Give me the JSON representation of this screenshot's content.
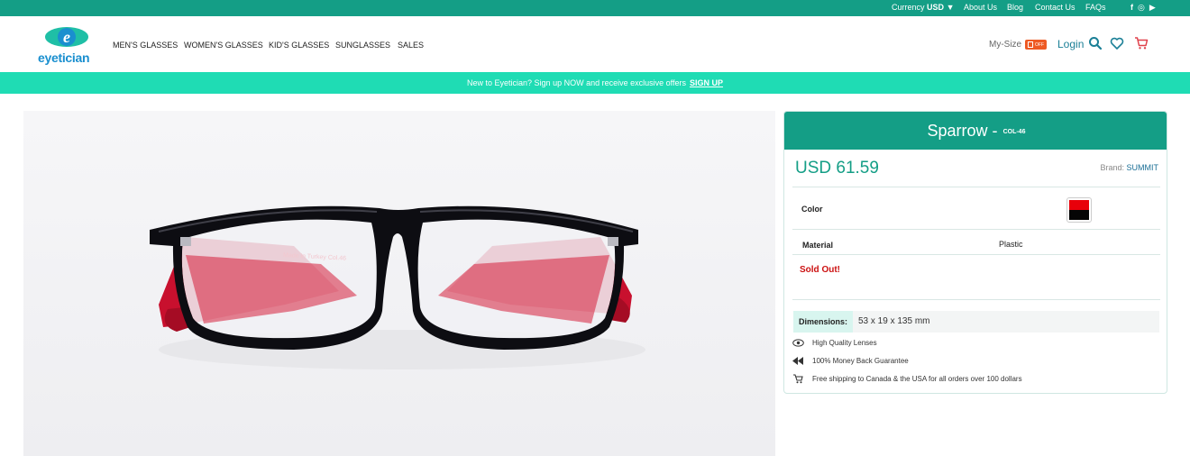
{
  "topbar": {
    "currency_label": "Currency",
    "currency_value": "USD",
    "currency_caret": "▼",
    "links": [
      "About Us",
      "Blog",
      "Contact Us",
      "FAQs"
    ],
    "social": [
      "f",
      "◎",
      "▶"
    ]
  },
  "header": {
    "logo_text": "eyetician",
    "nav": [
      "MEN'S GLASSES",
      "WOMEN'S GLASSES",
      "KID'S GLASSES",
      "SUNGLASSES",
      "SALES"
    ],
    "mysize_label": "My-Size",
    "mysize_badge": "OFF",
    "login_label": "Login"
  },
  "promo": {
    "text": "New to Eyetician? Sign up NOW and receive exclusive offers",
    "link": "SIGN UP"
  },
  "product": {
    "name": "Sparrow -",
    "code": "COL-46",
    "price": "USD 61.59",
    "brand_label": "Brand:",
    "brand_value": "SUMMIT",
    "color_label": "Color",
    "swatch_colors": {
      "top": "#e8000a",
      "bottom": "#050505"
    },
    "material_label": "Material",
    "material_value": "Plastic",
    "status": "Sold Out!",
    "dimensions_label": "Dimensions:",
    "dimensions_value": "53 x 19 x 135 mm",
    "features": [
      {
        "icon": "eye-icon",
        "text": "High Quality Lenses"
      },
      {
        "icon": "rewind-icon",
        "text": "100% Money Back Guarantee"
      },
      {
        "icon": "shipping-cart-icon",
        "text": "Free shipping to Canada & the USA for all orders over 100 dollars"
      }
    ],
    "temple_imprint": "Made in Turkey Col.46"
  },
  "colors": {
    "teal": "#149e86",
    "promo": "#1fdcb4",
    "accent_blue": "#1a7f96",
    "sold_out": "#cc1111"
  }
}
